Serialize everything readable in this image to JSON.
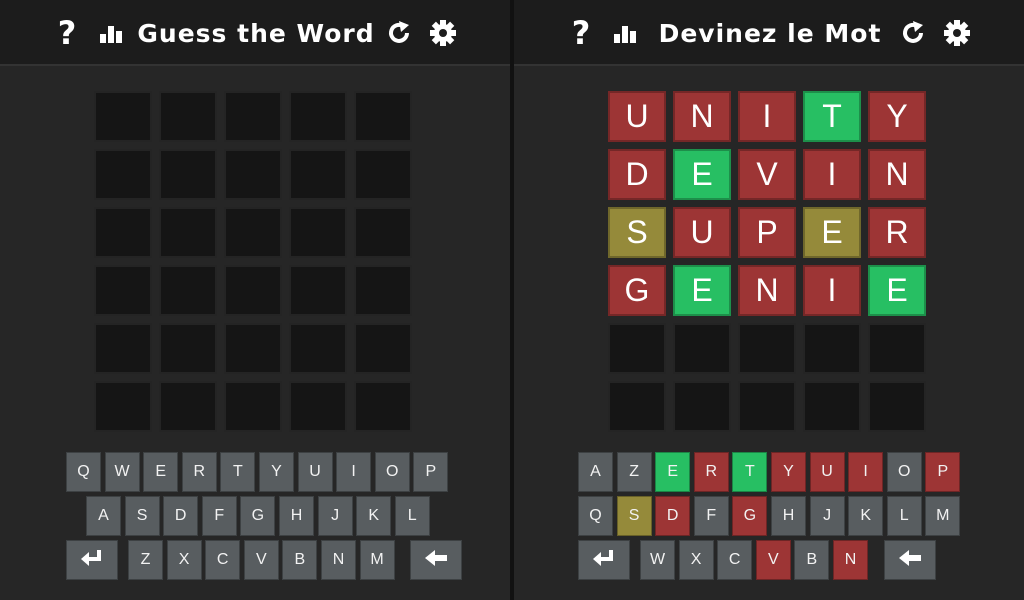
{
  "colors": {
    "correct": "#27bf63",
    "present": "#958a3a",
    "absent": "#9d3535",
    "empty": "#151515",
    "key": "#585d60"
  },
  "left": {
    "title": "Guess the Word",
    "icons": {
      "help": "question-mark",
      "stats": "bar-chart",
      "restart": "restart-arrow",
      "settings": "gear"
    },
    "help_glyph": "?",
    "board": [
      [
        {
          "l": "",
          "s": "empty"
        },
        {
          "l": "",
          "s": "empty"
        },
        {
          "l": "",
          "s": "empty"
        },
        {
          "l": "",
          "s": "empty"
        },
        {
          "l": "",
          "s": "empty"
        }
      ],
      [
        {
          "l": "",
          "s": "empty"
        },
        {
          "l": "",
          "s": "empty"
        },
        {
          "l": "",
          "s": "empty"
        },
        {
          "l": "",
          "s": "empty"
        },
        {
          "l": "",
          "s": "empty"
        }
      ],
      [
        {
          "l": "",
          "s": "empty"
        },
        {
          "l": "",
          "s": "empty"
        },
        {
          "l": "",
          "s": "empty"
        },
        {
          "l": "",
          "s": "empty"
        },
        {
          "l": "",
          "s": "empty"
        }
      ],
      [
        {
          "l": "",
          "s": "empty"
        },
        {
          "l": "",
          "s": "empty"
        },
        {
          "l": "",
          "s": "empty"
        },
        {
          "l": "",
          "s": "empty"
        },
        {
          "l": "",
          "s": "empty"
        }
      ],
      [
        {
          "l": "",
          "s": "empty"
        },
        {
          "l": "",
          "s": "empty"
        },
        {
          "l": "",
          "s": "empty"
        },
        {
          "l": "",
          "s": "empty"
        },
        {
          "l": "",
          "s": "empty"
        }
      ],
      [
        {
          "l": "",
          "s": "empty"
        },
        {
          "l": "",
          "s": "empty"
        },
        {
          "l": "",
          "s": "empty"
        },
        {
          "l": "",
          "s": "empty"
        },
        {
          "l": "",
          "s": "empty"
        }
      ]
    ],
    "keyboard": [
      [
        {
          "k": "Q"
        },
        {
          "k": "W"
        },
        {
          "k": "E"
        },
        {
          "k": "R"
        },
        {
          "k": "T"
        },
        {
          "k": "Y"
        },
        {
          "k": "U"
        },
        {
          "k": "I"
        },
        {
          "k": "O"
        },
        {
          "k": "P"
        }
      ],
      [
        {
          "k": "A"
        },
        {
          "k": "S"
        },
        {
          "k": "D"
        },
        {
          "k": "F"
        },
        {
          "k": "G"
        },
        {
          "k": "H"
        },
        {
          "k": "J"
        },
        {
          "k": "K"
        },
        {
          "k": "L"
        }
      ],
      [
        {
          "k": "enter",
          "t": "icon"
        },
        {
          "k": "Z"
        },
        {
          "k": "X"
        },
        {
          "k": "C"
        },
        {
          "k": "V"
        },
        {
          "k": "B"
        },
        {
          "k": "N"
        },
        {
          "k": "M"
        },
        {
          "k": "backspace",
          "t": "icon"
        }
      ]
    ]
  },
  "right": {
    "title": "Devinez le Mot",
    "icons": {
      "help": "question-mark",
      "stats": "bar-chart",
      "restart": "restart-arrow",
      "settings": "gear"
    },
    "help_glyph": "?",
    "board": [
      [
        {
          "l": "U",
          "s": "absent"
        },
        {
          "l": "N",
          "s": "absent"
        },
        {
          "l": "I",
          "s": "absent"
        },
        {
          "l": "T",
          "s": "correct"
        },
        {
          "l": "Y",
          "s": "absent"
        }
      ],
      [
        {
          "l": "D",
          "s": "absent"
        },
        {
          "l": "E",
          "s": "correct"
        },
        {
          "l": "V",
          "s": "absent"
        },
        {
          "l": "I",
          "s": "absent"
        },
        {
          "l": "N",
          "s": "absent"
        }
      ],
      [
        {
          "l": "S",
          "s": "present"
        },
        {
          "l": "U",
          "s": "absent"
        },
        {
          "l": "P",
          "s": "absent"
        },
        {
          "l": "E",
          "s": "present"
        },
        {
          "l": "R",
          "s": "absent"
        }
      ],
      [
        {
          "l": "G",
          "s": "absent"
        },
        {
          "l": "E",
          "s": "correct"
        },
        {
          "l": "N",
          "s": "absent"
        },
        {
          "l": "I",
          "s": "absent"
        },
        {
          "l": "E",
          "s": "correct"
        }
      ],
      [
        {
          "l": "",
          "s": "empty"
        },
        {
          "l": "",
          "s": "empty"
        },
        {
          "l": "",
          "s": "empty"
        },
        {
          "l": "",
          "s": "empty"
        },
        {
          "l": "",
          "s": "empty"
        }
      ],
      [
        {
          "l": "",
          "s": "empty"
        },
        {
          "l": "",
          "s": "empty"
        },
        {
          "l": "",
          "s": "empty"
        },
        {
          "l": "",
          "s": "empty"
        },
        {
          "l": "",
          "s": "empty"
        }
      ]
    ],
    "keyboard": [
      [
        {
          "k": "A"
        },
        {
          "k": "Z"
        },
        {
          "k": "E",
          "s": "correct"
        },
        {
          "k": "R",
          "s": "absent"
        },
        {
          "k": "T",
          "s": "correct"
        },
        {
          "k": "Y",
          "s": "absent"
        },
        {
          "k": "U",
          "s": "absent"
        },
        {
          "k": "I",
          "s": "absent"
        },
        {
          "k": "O"
        },
        {
          "k": "P",
          "s": "absent"
        }
      ],
      [
        {
          "k": "Q"
        },
        {
          "k": "S",
          "s": "present"
        },
        {
          "k": "D",
          "s": "absent"
        },
        {
          "k": "F"
        },
        {
          "k": "G",
          "s": "absent"
        },
        {
          "k": "H"
        },
        {
          "k": "J"
        },
        {
          "k": "K"
        },
        {
          "k": "L"
        },
        {
          "k": "M"
        }
      ],
      [
        {
          "k": "enter",
          "t": "icon"
        },
        {
          "k": "W"
        },
        {
          "k": "X"
        },
        {
          "k": "C"
        },
        {
          "k": "V",
          "s": "absent"
        },
        {
          "k": "B"
        },
        {
          "k": "N",
          "s": "absent"
        },
        {
          "k": "backspace",
          "t": "icon"
        }
      ]
    ]
  }
}
